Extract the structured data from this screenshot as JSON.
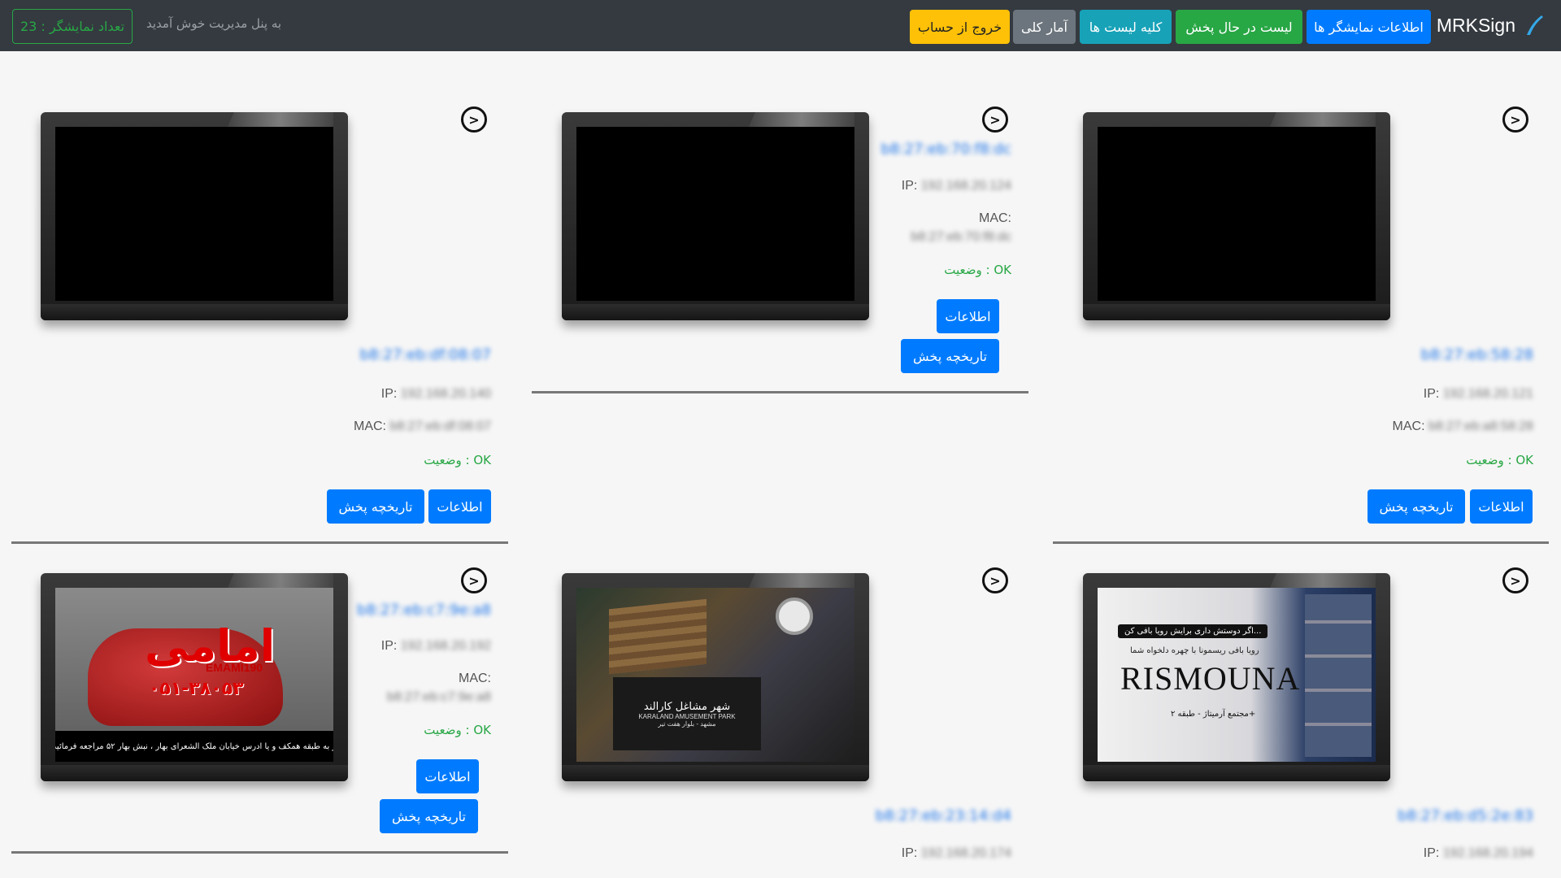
{
  "nav": {
    "brand": "MRKSign",
    "buttons": [
      {
        "label": "اطلاعات نمایشگر ها",
        "color": "#007bff"
      },
      {
        "label": "لیست در حال پخش",
        "color": "#28a745"
      },
      {
        "label": "کلیه لیست ها",
        "color": "#17a2b8"
      },
      {
        "label": "آمار کلی",
        "color": "#6c757d"
      },
      {
        "label": "خروج از حساب",
        "color": "#ffc107"
      }
    ],
    "welcome": "به پنل مدیریت خوش آمدید",
    "display_count": "تعداد نمایشگر : 23"
  },
  "labels": {
    "ip": "IP:",
    "mac": "MAC:",
    "status_ok": "وضعیت : OK",
    "info_btn": "اطلاعات",
    "history_btn": "تاریخچه پخش"
  },
  "cards": [
    {
      "title": "b8:27:eb:58:28",
      "ip": "192.168.20.121",
      "mac": "b8:27:eb:a8:58:28"
    },
    {
      "title": "b8:27:eb:70:f8:dc",
      "ip": "192.168.20.124",
      "mac": "b8:27:eb:70:f8:dc"
    },
    {
      "title": "b8:27:eb:df:08:07",
      "ip": "192.168.20.140",
      "mac": "b8:27:eb:df:08:07"
    },
    {
      "title": "b8:27:eb:d5:2e:83",
      "ip": "192.168.20.194"
    },
    {
      "title": "b8:27:eb:23:14:d4",
      "ip": "192.168.20.174"
    },
    {
      "title": "b8:27:eb:c7:9e:a8",
      "ip": "192.168.20.192",
      "mac": "b8:27:eb:c7:9e:a8"
    }
  ],
  "thumbnails": {
    "car": {
      "logo": "امامی",
      "brand": "EMAMI190",
      "phone": "۰۵۱-۳۸۰۵۳",
      "banner": "ر به طبقه همکف و یا ادرس خیابان ملک الشعرای بهار ، نبش بهار ۵۲ مراجعه فرمائید"
    },
    "park": {
      "title": "شهر مشاغل کارالند",
      "subtitle": "KARALAND AMUSEMENT PARK",
      "line": "مشهد - بلوار هفت تیر"
    },
    "rism": {
      "quote": "اگر دوستش داری برایش رویا بافی کن...",
      "sub": "رویا بافی ریسمونا با چهره دلخواه شما",
      "name": "RISMOUNA",
      "address": "مجتمع آرمیتاژ - طبقه ۲+"
    }
  }
}
